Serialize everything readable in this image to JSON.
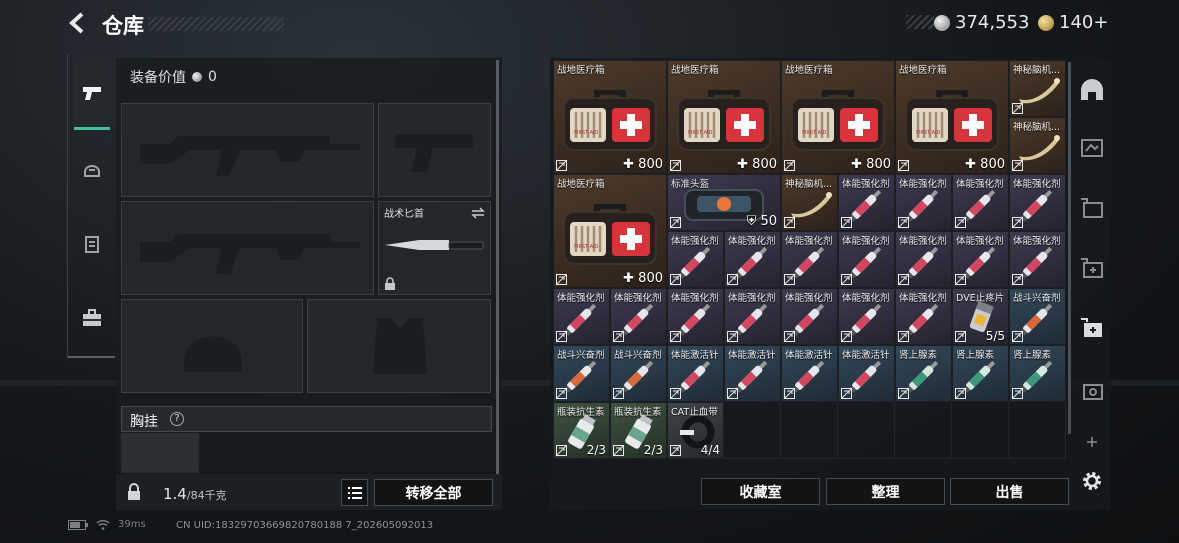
{
  "header": {
    "title": "仓库",
    "silver": "374,553",
    "gold": "140+"
  },
  "equipment": {
    "value_label": "装备价值",
    "value": "0",
    "knife_label": "战术匕首",
    "chest_label": "胸挂",
    "chest_help": "?",
    "weight": "1.4",
    "weight_max": "/84千克",
    "transfer_all": "转移全部"
  },
  "inventory": {
    "items": [
      {
        "name": "战地医疗箱",
        "count": "800",
        "type": "medkit",
        "rarity": "brown",
        "col": 0,
        "row": 0,
        "w": 2,
        "h": 2
      },
      {
        "name": "战地医疗箱",
        "count": "800",
        "type": "medkit",
        "rarity": "brown",
        "col": 2,
        "row": 0,
        "w": 2,
        "h": 2
      },
      {
        "name": "战地医疗箱",
        "count": "800",
        "type": "medkit",
        "rarity": "brown",
        "col": 4,
        "row": 0,
        "w": 2,
        "h": 2
      },
      {
        "name": "战地医疗箱",
        "count": "800",
        "type": "medkit",
        "rarity": "brown",
        "col": 6,
        "row": 0,
        "w": 2,
        "h": 2
      },
      {
        "name": "神秘脑机...",
        "count": "",
        "type": "relic",
        "rarity": "brown",
        "col": 8,
        "row": 0,
        "w": 1,
        "h": 1
      },
      {
        "name": "神秘脑机...",
        "count": "",
        "type": "relic",
        "rarity": "brown",
        "col": 8,
        "row": 1,
        "w": 1,
        "h": 1
      },
      {
        "name": "战地医疗箱",
        "count": "800",
        "type": "medkit",
        "rarity": "brown",
        "col": 0,
        "row": 2,
        "w": 2,
        "h": 2
      },
      {
        "name": "标准头盔",
        "count": "50",
        "type": "helmet",
        "rarity": "purple",
        "col": 2,
        "row": 2,
        "w": 2,
        "h": 1
      },
      {
        "name": "神秘脑机...",
        "count": "",
        "type": "relic",
        "rarity": "brown",
        "col": 4,
        "row": 2,
        "w": 1,
        "h": 1
      },
      {
        "name": "体能强化剂",
        "count": "",
        "type": "inj-red",
        "rarity": "purple",
        "col": 5,
        "row": 2,
        "w": 1,
        "h": 1
      },
      {
        "name": "体能强化剂",
        "count": "",
        "type": "inj-red",
        "rarity": "purple",
        "col": 6,
        "row": 2,
        "w": 1,
        "h": 1
      },
      {
        "name": "体能强化剂",
        "count": "",
        "type": "inj-red",
        "rarity": "purple",
        "col": 7,
        "row": 2,
        "w": 1,
        "h": 1
      },
      {
        "name": "体能强化剂",
        "count": "",
        "type": "inj-red",
        "rarity": "purple",
        "col": 8,
        "row": 2,
        "w": 1,
        "h": 1
      },
      {
        "name": "体能强化剂",
        "count": "",
        "type": "inj-red",
        "rarity": "purple",
        "col": 2,
        "row": 3,
        "w": 1,
        "h": 1
      },
      {
        "name": "体能强化剂",
        "count": "",
        "type": "inj-red",
        "rarity": "purple",
        "col": 3,
        "row": 3,
        "w": 1,
        "h": 1
      },
      {
        "name": "体能强化剂",
        "count": "",
        "type": "inj-red",
        "rarity": "purple",
        "col": 4,
        "row": 3,
        "w": 1,
        "h": 1
      },
      {
        "name": "体能强化剂",
        "count": "",
        "type": "inj-red",
        "rarity": "purple",
        "col": 5,
        "row": 3,
        "w": 1,
        "h": 1
      },
      {
        "name": "体能强化剂",
        "count": "",
        "type": "inj-red",
        "rarity": "purple",
        "col": 6,
        "row": 3,
        "w": 1,
        "h": 1
      },
      {
        "name": "体能强化剂",
        "count": "",
        "type": "inj-red",
        "rarity": "purple",
        "col": 7,
        "row": 3,
        "w": 1,
        "h": 1
      },
      {
        "name": "体能强化剂",
        "count": "",
        "type": "inj-red",
        "rarity": "purple",
        "col": 8,
        "row": 3,
        "w": 1,
        "h": 1
      },
      {
        "name": "体能强化剂",
        "count": "",
        "type": "inj-red",
        "rarity": "purple",
        "col": 0,
        "row": 4,
        "w": 1,
        "h": 1
      },
      {
        "name": "体能强化剂",
        "count": "",
        "type": "inj-red",
        "rarity": "purple",
        "col": 1,
        "row": 4,
        "w": 1,
        "h": 1
      },
      {
        "name": "体能强化剂",
        "count": "",
        "type": "inj-red",
        "rarity": "purple",
        "col": 2,
        "row": 4,
        "w": 1,
        "h": 1
      },
      {
        "name": "体能强化剂",
        "count": "",
        "type": "inj-red",
        "rarity": "purple",
        "col": 3,
        "row": 4,
        "w": 1,
        "h": 1
      },
      {
        "name": "体能强化剂",
        "count": "",
        "type": "inj-red",
        "rarity": "purple",
        "col": 4,
        "row": 4,
        "w": 1,
        "h": 1
      },
      {
        "name": "体能强化剂",
        "count": "",
        "type": "inj-red",
        "rarity": "purple",
        "col": 5,
        "row": 4,
        "w": 1,
        "h": 1
      },
      {
        "name": "体能强化剂",
        "count": "",
        "type": "inj-red",
        "rarity": "purple",
        "col": 6,
        "row": 4,
        "w": 1,
        "h": 1
      },
      {
        "name": "DVE止疼片",
        "count": "5/5",
        "type": "pills",
        "rarity": "purple",
        "col": 7,
        "row": 4,
        "w": 1,
        "h": 1
      },
      {
        "name": "战斗兴奋剂",
        "count": "",
        "type": "inj-orange",
        "rarity": "blue",
        "col": 8,
        "row": 4,
        "w": 1,
        "h": 1
      },
      {
        "name": "战斗兴奋剂",
        "count": "",
        "type": "inj-orange",
        "rarity": "blue",
        "col": 0,
        "row": 5,
        "w": 1,
        "h": 1
      },
      {
        "name": "战斗兴奋剂",
        "count": "",
        "type": "inj-orange",
        "rarity": "blue",
        "col": 1,
        "row": 5,
        "w": 1,
        "h": 1
      },
      {
        "name": "体能激活针",
        "count": "",
        "type": "inj-red",
        "rarity": "blue",
        "col": 2,
        "row": 5,
        "w": 1,
        "h": 1
      },
      {
        "name": "体能激活针",
        "count": "",
        "type": "inj-red",
        "rarity": "blue",
        "col": 3,
        "row": 5,
        "w": 1,
        "h": 1
      },
      {
        "name": "体能激活针",
        "count": "",
        "type": "inj-red",
        "rarity": "blue",
        "col": 4,
        "row": 5,
        "w": 1,
        "h": 1
      },
      {
        "name": "体能激活针",
        "count": "",
        "type": "inj-red",
        "rarity": "blue",
        "col": 5,
        "row": 5,
        "w": 1,
        "h": 1
      },
      {
        "name": "肾上腺素",
        "count": "",
        "type": "inj-green",
        "rarity": "blue",
        "col": 6,
        "row": 5,
        "w": 1,
        "h": 1
      },
      {
        "name": "肾上腺素",
        "count": "",
        "type": "inj-green",
        "rarity": "blue",
        "col": 7,
        "row": 5,
        "w": 1,
        "h": 1
      },
      {
        "name": "肾上腺素",
        "count": "",
        "type": "inj-green",
        "rarity": "blue",
        "col": 8,
        "row": 5,
        "w": 1,
        "h": 1
      },
      {
        "name": "瓶装抗生素",
        "count": "2/3",
        "type": "bottle",
        "rarity": "green",
        "col": 0,
        "row": 6,
        "w": 1,
        "h": 1
      },
      {
        "name": "瓶装抗生素",
        "count": "2/3",
        "type": "bottle",
        "rarity": "green",
        "col": 1,
        "row": 6,
        "w": 1,
        "h": 1
      },
      {
        "name": "CAT止血带",
        "count": "4/4",
        "type": "tourniquet",
        "rarity": "grey",
        "col": 2,
        "row": 6,
        "w": 1,
        "h": 1
      }
    ],
    "collection": "收藏室",
    "sort": "整理",
    "sell": "出售"
  },
  "status": {
    "ping": "39ms",
    "uid": "CN UID:18329703669820780188 7_202605092013"
  },
  "colors": {
    "accent": "#3ec29c",
    "medical_red": "#d8343b"
  }
}
